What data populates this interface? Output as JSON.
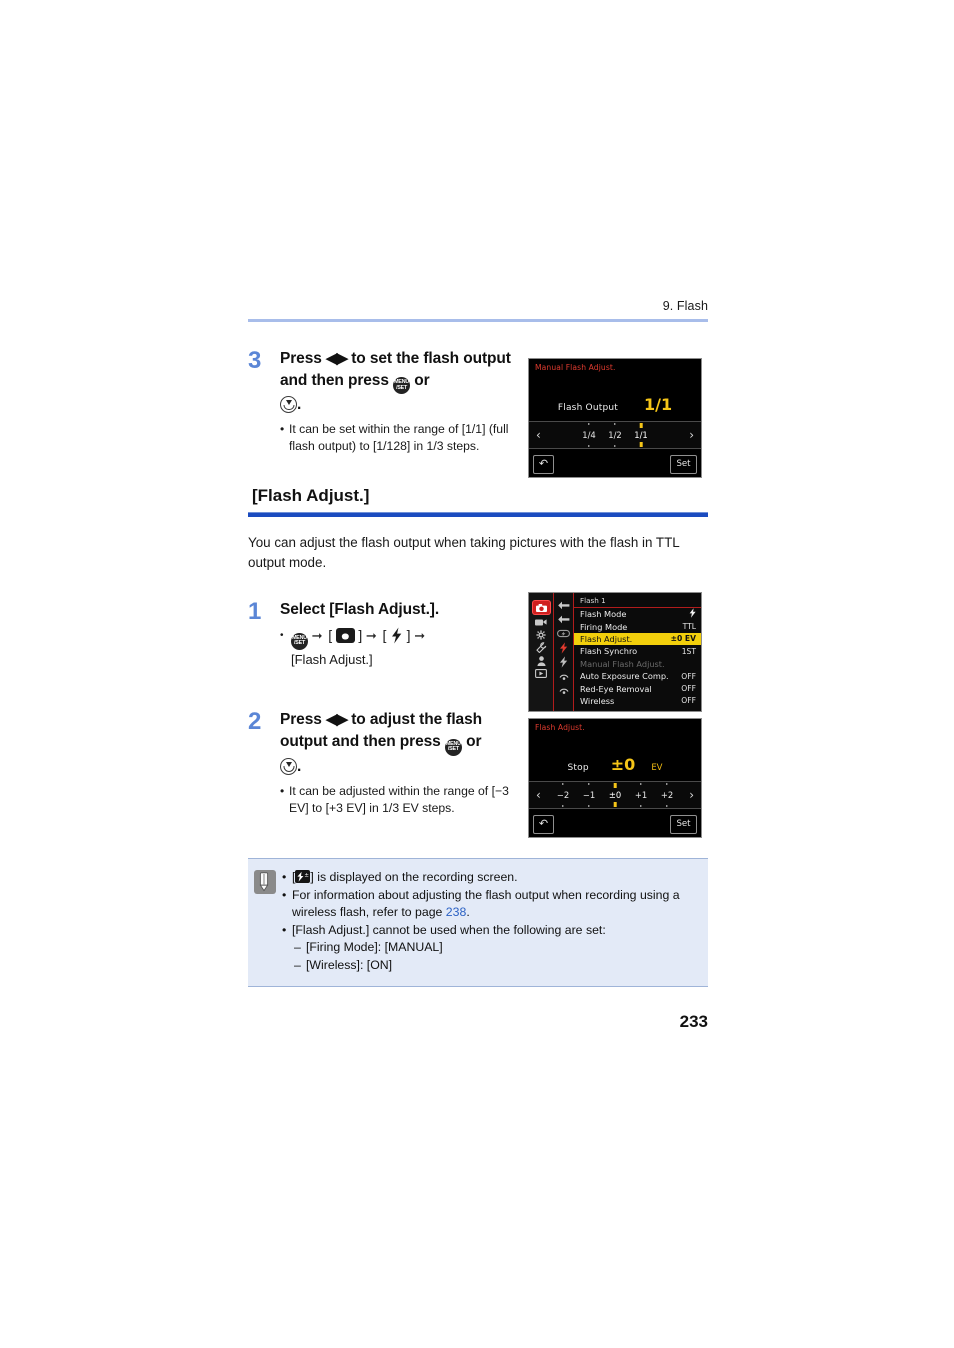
{
  "header": {
    "chapter": "9. Flash"
  },
  "step3": {
    "number": "3",
    "title_line1_pre": "Press",
    "title_arrows": "◀▶",
    "title_line1_post": "to set the flash",
    "title_line2_pre": "output and then press",
    "title_line2_or": "or",
    "title_line3_period": ".",
    "bullet": "It can be set within the range of [1/1] (full flash output) to [1/128] in 1/3 steps.",
    "screen": {
      "title": "Manual Flash Adjust.",
      "label": "Flash Output",
      "value": "1/1",
      "scale": [
        "1/4",
        "1/2",
        "1/1"
      ],
      "current": "1/1",
      "arrow_left": "‹",
      "arrow_right": "›",
      "back": "↶",
      "set": "Set"
    }
  },
  "section": {
    "title": "[Flash Adjust.]",
    "intro": "You can adjust the flash output when taking pictures with the flash in TTL output mode."
  },
  "step1": {
    "number": "1",
    "title": "Select [Flash Adjust.].",
    "path_tail": "[Flash Adjust.]",
    "menu": {
      "tab_title": "Flash 1",
      "rows": [
        {
          "label": "Flash Mode",
          "value": "⚡",
          "state": "normal",
          "value_is_icon": true
        },
        {
          "label": "Firing Mode",
          "value": "TTL",
          "state": "normal"
        },
        {
          "label": "Flash Adjust.",
          "value": "±0  EV",
          "state": "selected"
        },
        {
          "label": "Flash Synchro",
          "value": "1ST",
          "state": "normal"
        },
        {
          "label": "Manual Flash Adjust.",
          "value": "",
          "state": "dim"
        },
        {
          "label": "Auto Exposure Comp.",
          "value": "OFF",
          "state": "normal"
        },
        {
          "label": "Red-Eye Removal",
          "value": "OFF",
          "state": "normal"
        },
        {
          "label": "Wireless",
          "value": "OFF",
          "state": "normal"
        }
      ]
    }
  },
  "step2": {
    "number": "2",
    "title_line1_pre": "Press",
    "title_arrows": "◀▶",
    "title_line1_post": "to adjust the flash",
    "title_line2_pre": "output and then press",
    "title_line2_or": "or",
    "title_line3_period": ".",
    "bullet": "It can be adjusted within the range of [−3 EV] to [+3 EV] in 1/3 EV steps.",
    "screen": {
      "title": "Flash Adjust.",
      "label": "Stop",
      "value": "±0",
      "unit": "EV",
      "scale": [
        "−2",
        "−1",
        "±0",
        "+1",
        "+2"
      ],
      "current": "±0",
      "arrow_left": "‹",
      "arrow_right": "›",
      "back": "↶",
      "set": "Set"
    }
  },
  "note": {
    "item1_pre": "[",
    "item1_post": "] is displayed on the recording screen.",
    "item2": "For information about adjusting the flash output when recording using a wireless flash, refer to page ",
    "item2_link": "238",
    "item2_end": ".",
    "item3": "[Flash Adjust.] cannot be used when the following are set:",
    "item3_sub1": "[Firing Mode]: [MANUAL]",
    "item3_sub2": "[Wireless]: [ON]",
    "dash": "–",
    "bullet": "•"
  },
  "footer": {
    "page_number": "233"
  },
  "colors": {
    "step_number": "#5b86d6",
    "header_rule": "#a8bdea",
    "section_rule": "#1b4bbf",
    "note_bg": "#e3eaf7",
    "link": "#2b61c4",
    "lcd_highlight": "#f2cf0c",
    "lcd_title_red": "#e03b2f",
    "lcd_value_yellow": "#f5c518"
  }
}
